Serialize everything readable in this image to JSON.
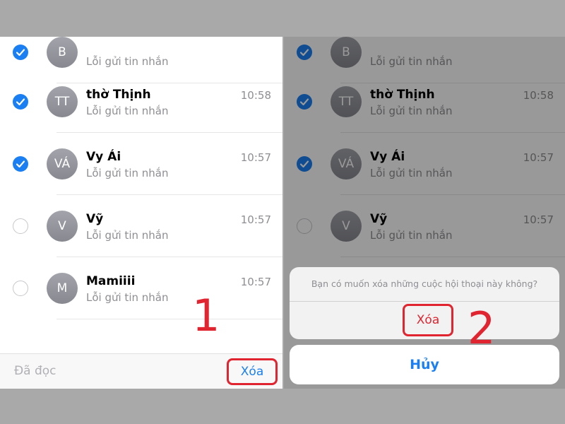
{
  "left": {
    "conversations": [
      {
        "initials": "B",
        "name": "",
        "preview": "Lỗi gửi tin nhắn",
        "time": "",
        "checked": true
      },
      {
        "initials": "TT",
        "name": "thờ Thịnh",
        "preview": "Lỗi gửi tin nhắn",
        "time": "10:58",
        "checked": true
      },
      {
        "initials": "VÁ",
        "name": "Vy Ái",
        "preview": "Lỗi gửi tin nhắn",
        "time": "10:57",
        "checked": true
      },
      {
        "initials": "V",
        "name": "Vỹ",
        "preview": "Lỗi gửi tin nhắn",
        "time": "10:57",
        "checked": false
      },
      {
        "initials": "M",
        "name": "Mamiiii",
        "preview": "Lỗi gửi tin nhắn",
        "time": "10:57",
        "checked": false
      }
    ],
    "toolbar": {
      "mark_read_label": "Đã đọc",
      "delete_label": "Xóa"
    },
    "step_label": "1"
  },
  "right": {
    "conversations": [
      {
        "initials": "B",
        "name": "",
        "preview": "Lỗi gửi tin nhắn",
        "time": "",
        "checked": true
      },
      {
        "initials": "TT",
        "name": "thờ Thịnh",
        "preview": "Lỗi gửi tin nhắn",
        "time": "10:58",
        "checked": true
      },
      {
        "initials": "VÁ",
        "name": "Vy Ái",
        "preview": "Lỗi gửi tin nhắn",
        "time": "10:57",
        "checked": true
      },
      {
        "initials": "V",
        "name": "Vỹ",
        "preview": "Lỗi gửi tin nhắn",
        "time": "10:57",
        "checked": false
      }
    ],
    "dialog": {
      "message": "Bạn có muốn xóa những cuộc hội thoại này không?",
      "confirm_label": "Xóa",
      "cancel_label": "Hủy"
    },
    "step_label": "2"
  },
  "colors": {
    "accent": "#1a7ff2",
    "highlight": "#e02430",
    "avatar": "#9b9ca3"
  }
}
